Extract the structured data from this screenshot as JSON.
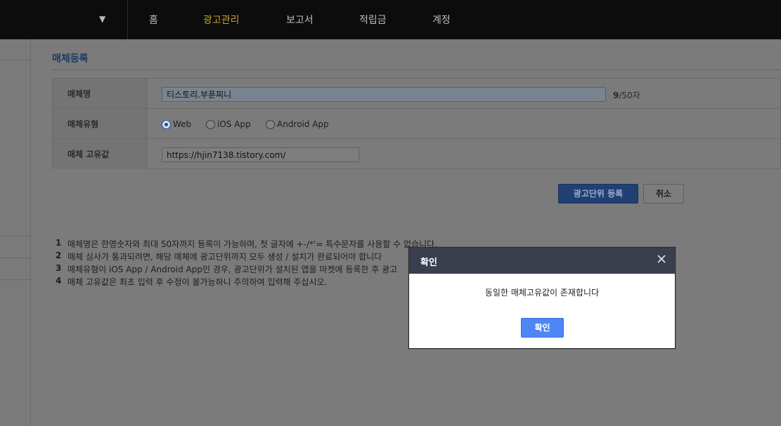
{
  "nav": {
    "dropdown_icon": "caret-down-icon",
    "items": [
      {
        "label": "홈"
      },
      {
        "label": "광고관리",
        "active": true
      },
      {
        "label": "보고서"
      },
      {
        "label": "적립금"
      },
      {
        "label": "계정"
      }
    ],
    "active_color": "#c9a22b"
  },
  "page": {
    "title": "매체등록"
  },
  "form": {
    "name_label": "매체명",
    "name_value": "티스토리.부푼찌니",
    "name_count": "9",
    "name_max": "/50자",
    "type_label": "매체유형",
    "type_options": [
      {
        "label": "Web",
        "checked": true
      },
      {
        "label": "iOS App",
        "checked": false
      },
      {
        "label": "Android App",
        "checked": false
      }
    ],
    "uid_label": "매체 고유값",
    "uid_value": "https://hjin7138.tistory.com/"
  },
  "actions": {
    "register_label": "광고단위 등록",
    "cancel_label": "취소"
  },
  "notes": [
    {
      "num": "1",
      "text": "매체명은 한영숫자와 최대 50자까지 등록이 가능하며, 첫 글자에 +-/*'= 특수문자를 사용할 수 없습니다."
    },
    {
      "num": "2",
      "text": "매체 심사가 통과되려면, 해당 매체에 광고단위까지 모두 생성 / 설치가 완료되어야 합니다"
    },
    {
      "num": "3",
      "text": "매체유형이 iOS App / Android App인 경우, 광고단위가 설치된 앱을 마켓에 등록한 후 광고"
    },
    {
      "num": "4",
      "text": "매체 고유값은 최초 입력 후 수정이 불가능하니 주의하여 입력해 주십시오."
    }
  ],
  "dialog": {
    "title": "확인",
    "close_icon": "close-icon",
    "message": "동일한 매체고유값이 존재합니다",
    "ok_label": "확인",
    "ok_color": "#4f86f5"
  }
}
